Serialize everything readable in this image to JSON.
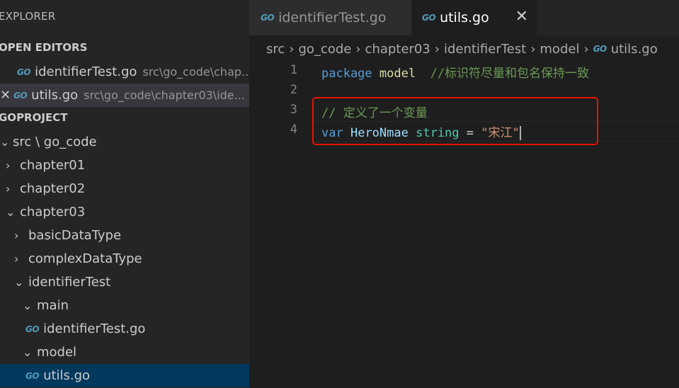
{
  "explorer": {
    "title": "EXPLORER",
    "open_editors_label": "OPEN EDITORS",
    "open_editors": [
      {
        "name": "identifierTest.go",
        "path": "src\\go_code\\chap..."
      },
      {
        "name": "utils.go",
        "path": "src\\go_code\\chapter03\\ide..."
      }
    ],
    "project_label": "GOPROJECT",
    "tree": {
      "root": "src \\ go_code",
      "chapter01": "chapter01",
      "chapter02": "chapter02",
      "chapter03": "chapter03",
      "basicDataType": "basicDataType",
      "complexDataType": "complexDataType",
      "identifierTest": "identifierTest",
      "main": "main",
      "main_file": "identifierTest.go",
      "model": "model",
      "model_file": "utils.go"
    }
  },
  "tabs": [
    {
      "label": "identifierTest.go"
    },
    {
      "label": "utils.go"
    }
  ],
  "breadcrumb": [
    "src",
    "go_code",
    "chapter03",
    "identifierTest",
    "model",
    "utils.go"
  ],
  "editor": {
    "lines": {
      "l1": {
        "num": "1",
        "kw": "package",
        "pkg": "model",
        "comment": "//标识符尽量和包名保持一致"
      },
      "l2": {
        "num": "2"
      },
      "l3": {
        "num": "3",
        "comment": "// 定义了一个变量"
      },
      "l4": {
        "num": "4",
        "kw": "var",
        "ident": "HeroNmae",
        "type": "string",
        "op": "=",
        "str": "\"宋江\""
      }
    }
  },
  "icons": {
    "go_file": "go-icon",
    "chevron_right": "chevron-right-icon",
    "chevron_down": "chevron-down-icon",
    "close": "close-icon"
  },
  "colors": {
    "go_icon": "#519aba",
    "highlight_box": "#e51400"
  }
}
